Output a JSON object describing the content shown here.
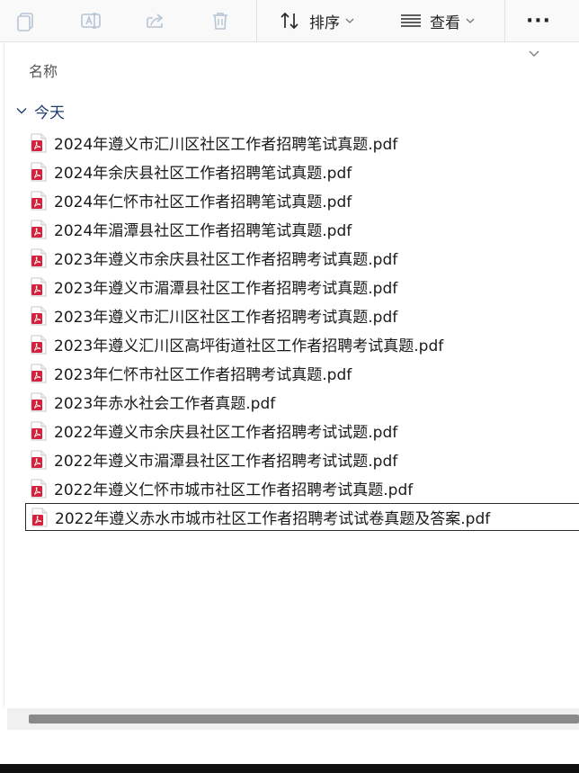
{
  "toolbar": {
    "copy_icon": "copy-icon",
    "rename_icon": "rename-icon",
    "share_icon": "share-icon",
    "delete_icon": "trash-icon",
    "sort_label": "排序",
    "view_label": "查看",
    "more_label": "···"
  },
  "list": {
    "column_header": "名称",
    "group_label": "今天",
    "files": [
      "2024年遵义市汇川区社区工作者招聘笔试真题.pdf",
      "2024年余庆县社区工作者招聘笔试真题.pdf",
      "2024年仁怀市社区工作者招聘笔试真题.pdf",
      "2024年湄潭县社区工作者招聘笔试真题.pdf",
      "2023年遵义市余庆县社区工作者招聘考试真题.pdf",
      "2023年遵义市湄潭县社区工作者招聘考试真题.pdf",
      "2023年遵义市汇川区社区工作者招聘考试真题.pdf",
      "2023年遵义汇川区高坪街道社区工作者招聘考试真题.pdf",
      "2023年仁怀市社区工作者招聘考试真题.pdf",
      "2023年赤水社会工作者真题.pdf",
      "2022年遵义市余庆县社区工作者招聘考试试题.pdf",
      "2022年遵义市湄潭县社区工作者招聘考试试题.pdf",
      "2022年遵义仁怀市城市社区工作者招聘考试真题.pdf",
      "2022年遵义赤水市城市社区工作者招聘考试试卷真题及答案.pdf"
    ]
  },
  "colors": {
    "pdf_red": "#d4213d",
    "accent": "#1f3b70"
  }
}
